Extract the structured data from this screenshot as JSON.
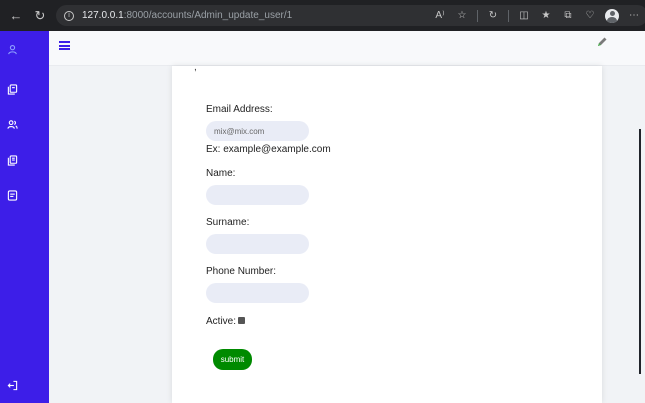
{
  "browser": {
    "url_host": "127.0.0.1",
    "url_path": ":8000/accounts/Admin_update_user/1",
    "reader_label": "A⁾"
  },
  "sidebar": {
    "items": [
      {
        "icon": "user-icon"
      },
      {
        "icon": "file-stack-icon"
      },
      {
        "icon": "users-icon"
      },
      {
        "icon": "document-icon"
      },
      {
        "icon": "list-document-icon"
      },
      {
        "icon": "logout-icon"
      }
    ]
  },
  "form": {
    "email_label": "Email Address:",
    "email_placeholder": "mix@mix.com",
    "email_hint": "Ex: example@example.com",
    "name_label": "Name:",
    "surname_label": "Surname:",
    "phone_label": "Phone Number:",
    "active_label": "Active:",
    "submit_label": "submit"
  },
  "colors": {
    "sidebar": "#3d1ee8",
    "submit": "#008a00",
    "field": "#e9ecf6"
  }
}
